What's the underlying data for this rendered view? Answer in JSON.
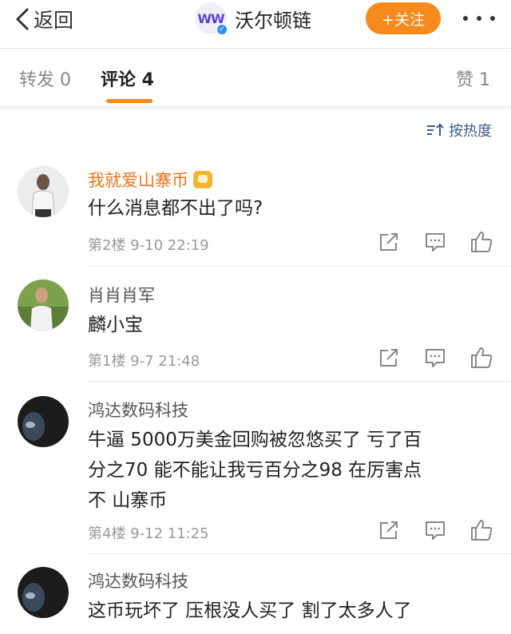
{
  "nav": {
    "back_label": "返回",
    "account_name": "沃尔顿链",
    "follow_label": "+关注"
  },
  "tabs": {
    "repost": "转发 0",
    "comments": "评论 4",
    "likes": "赞 1"
  },
  "sort_label": "按热度",
  "colors": {
    "accent": "#f78a1c",
    "vip_name": "#e8751a",
    "link": "#3a5a8c"
  },
  "comments": [
    {
      "name": "我就爱山寨币",
      "vip": true,
      "text": "什么消息都不出了吗?",
      "meta": "第2楼  9-10 22:19"
    },
    {
      "name": "肖肖肖军",
      "vip": false,
      "text": "麟小宝",
      "meta": "第1楼  9-7 21:48"
    },
    {
      "name": "鸿达数码科技",
      "vip": false,
      "text_lines": [
        "牛逼   5000万美金回购被忽悠买了   亏了百",
        "分之70   能不能让我亏百分之98   在厉害点",
        "不   山寨币"
      ],
      "meta": "第4楼  9-12 11:25"
    },
    {
      "name": "鸿达数码科技",
      "vip": false,
      "text": "这币玩坏了  压根没人买了    割了太多人了"
    }
  ]
}
